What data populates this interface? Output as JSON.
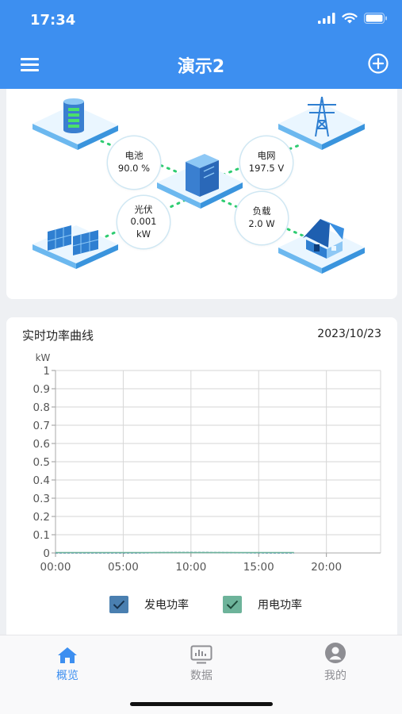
{
  "status_bar": {
    "time": "17:34"
  },
  "header": {
    "title": "演示2"
  },
  "energy_flow": {
    "battery": {
      "label": "电池",
      "value": "90.0 %"
    },
    "grid": {
      "label": "电网",
      "value": "197.5 V"
    },
    "pv": {
      "label": "光伏",
      "value": "0.001",
      "unit": "kW"
    },
    "load": {
      "label": "负载",
      "value": "2.0 W"
    }
  },
  "chart_card": {
    "title": "实时功率曲线",
    "date": "2023/10/23"
  },
  "chart_data": {
    "type": "line",
    "ylabel": "kW",
    "ylim": [
      0,
      1
    ],
    "y_ticks": [
      "0",
      "0.1",
      "0.2",
      "0.3",
      "0.4",
      "0.5",
      "0.6",
      "0.7",
      "0.8",
      "0.9",
      "1"
    ],
    "x_ticks": [
      "00:00",
      "05:00",
      "10:00",
      "15:00",
      "20:00"
    ],
    "x_range_hours": [
      0,
      24
    ],
    "series": [
      {
        "name": "发电功率",
        "color": "#4a7fb0",
        "x_hours": [
          0,
          2,
          4,
          6,
          8,
          10,
          12,
          14,
          16,
          17.6
        ],
        "values": [
          0,
          0,
          0,
          0,
          0.002,
          0.003,
          0.002,
          0.001,
          0,
          0
        ]
      },
      {
        "name": "用电功率",
        "color": "#6db39a",
        "x_hours": [
          0,
          2,
          4,
          6,
          8,
          10,
          12,
          14,
          16,
          17.6
        ],
        "values": [
          0.002,
          0.002,
          0.002,
          0.002,
          0.002,
          0.002,
          0.002,
          0.002,
          0.002,
          0.002
        ]
      }
    ],
    "grid": true,
    "legend_position": "bottom"
  },
  "tabs": [
    {
      "label": "概览",
      "icon": "home-icon",
      "active": true
    },
    {
      "label": "数据",
      "icon": "monitor-icon",
      "active": false
    },
    {
      "label": "我的",
      "icon": "user-icon",
      "active": false
    }
  ],
  "colors": {
    "accent": "#3d8ff0",
    "inactive": "#8e8e93"
  }
}
